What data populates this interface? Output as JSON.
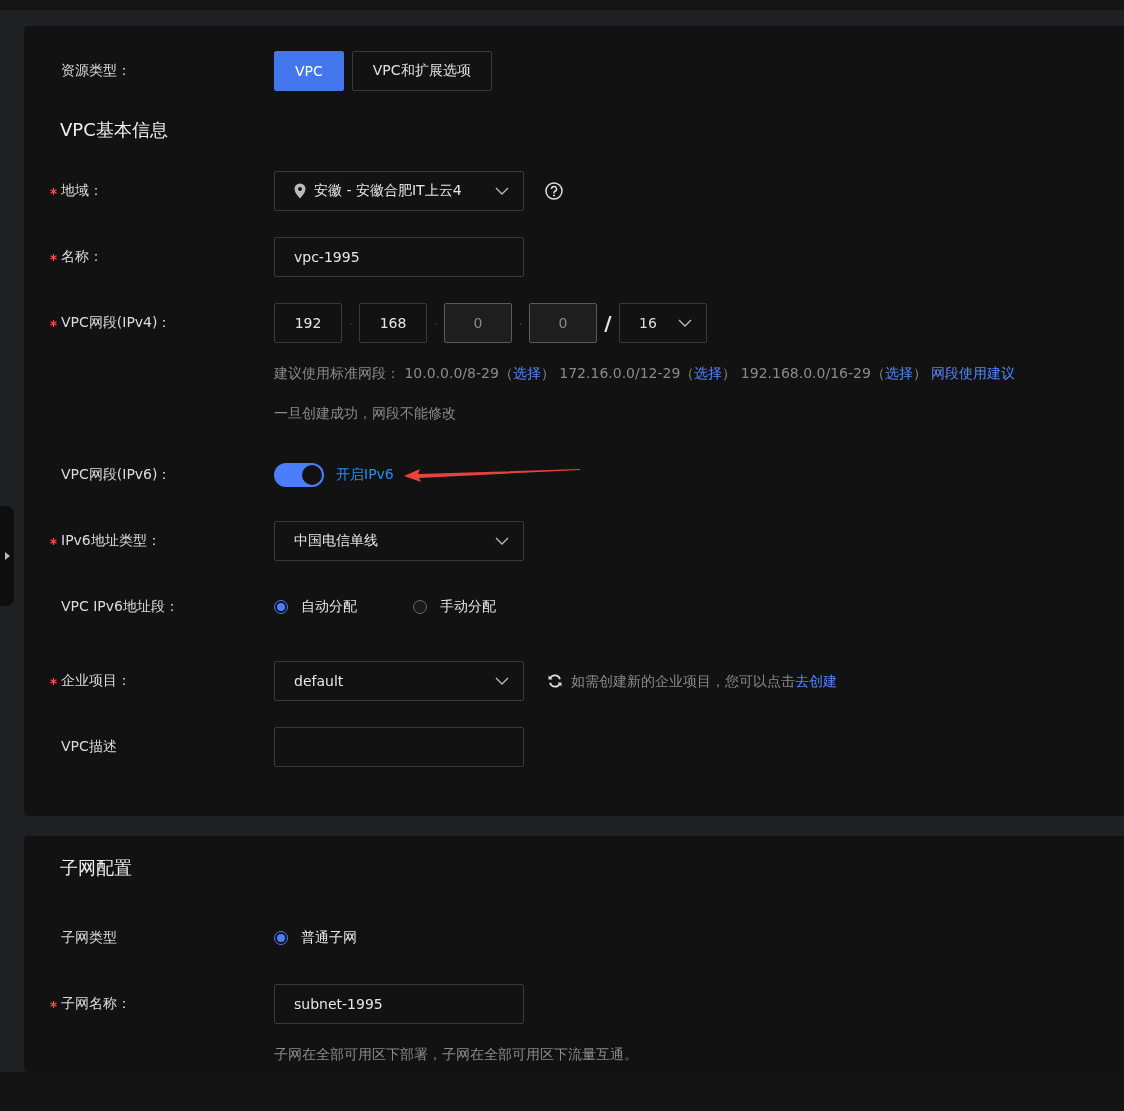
{
  "resource_type": {
    "label": "资源类型：",
    "options": [
      {
        "label": "VPC",
        "selected": true
      },
      {
        "label": "VPC和扩展选项",
        "selected": false
      }
    ]
  },
  "basic_section": {
    "title": "VPC基本信息",
    "fields": [
      {
        "kind": "region",
        "label": "地域：",
        "required": true,
        "value": "安徽 - 安徽合肥IT上云4"
      },
      {
        "kind": "input",
        "label": "名称：",
        "required": true,
        "value": "vpc-1995"
      },
      {
        "kind": "ip",
        "label": "VPC网段(IPv4)：",
        "required": true,
        "octets": [
          {
            "value": "192",
            "disabled": false
          },
          {
            "value": "168",
            "disabled": false
          },
          {
            "value": "0",
            "disabled": true
          },
          {
            "value": "0",
            "disabled": true
          }
        ],
        "octet_separator": "·",
        "slash": "/",
        "mask": "16",
        "suggestion": {
          "prefix": "建议使用标准网段：",
          "ranges": [
            {
              "range": "10.0.0.0/8-29（",
              "link": "选择",
              "close": "）"
            },
            {
              "range": "172.16.0.0/12-29（",
              "link": "选择",
              "close": "）"
            },
            {
              "range": "192.168.0.0/16-29（",
              "link": "选择",
              "close": "）"
            }
          ],
          "advice_link": "网段使用建议"
        },
        "note": "一旦创建成功，网段不能修改"
      },
      {
        "kind": "toggle",
        "label": "VPC网段(IPv6)：",
        "required": false,
        "on": true,
        "text": "开启IPv6"
      },
      {
        "kind": "select",
        "label": "IPv6地址类型：",
        "required": true,
        "value": "中国电信单线"
      },
      {
        "kind": "radio",
        "label": "VPC IPv6地址段：",
        "required": false,
        "options": [
          {
            "label": "自动分配",
            "selected": true
          },
          {
            "label": "手动分配",
            "selected": false
          }
        ]
      },
      {
        "kind": "select",
        "label": "企业项目：",
        "required": true,
        "value": "default",
        "hint": {
          "text": "如需创建新的企业项目，您可以点击",
          "link": "去创建"
        }
      },
      {
        "kind": "input",
        "label": "VPC描述",
        "required": false
      }
    ]
  },
  "subnet_section": {
    "title": "子网配置",
    "fields": [
      {
        "kind": "radio",
        "label": "子网类型",
        "required": false,
        "options": [
          {
            "label": "普通子网",
            "selected": true
          }
        ]
      },
      {
        "kind": "input",
        "label": "子网名称：",
        "required": true,
        "value": "subnet-1995",
        "note": "子网在全部可用区下部署，子网在全部可用区下流量互通。"
      }
    ]
  }
}
